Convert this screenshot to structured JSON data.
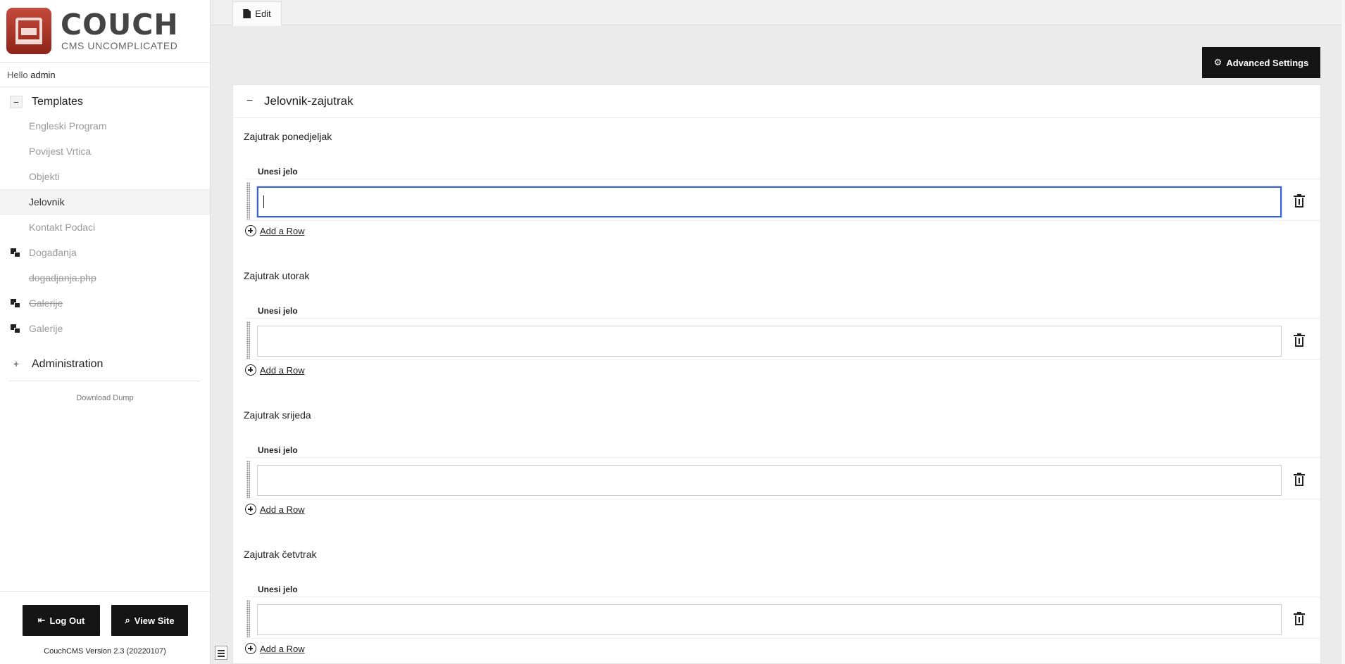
{
  "sidebar": {
    "logo_word": "COUCH",
    "logo_tagline": "CMS UNCOMPLICATED",
    "hello_prefix": "Hello",
    "username": "admin",
    "templates_label": "Templates",
    "templates_toggle": "−",
    "items": [
      {
        "label": "Engleski Program"
      },
      {
        "label": "Povijest Vrtica"
      },
      {
        "label": "Objekti"
      },
      {
        "label": "Jelovnik"
      },
      {
        "label": "Kontakt Podaci"
      },
      {
        "label": "Događanja"
      },
      {
        "label": "dogadjanja.php"
      },
      {
        "label": "Galerije"
      },
      {
        "label": "Galerije"
      }
    ],
    "admin_label": "Administration",
    "admin_toggle": "+",
    "download_label": "Download Dump",
    "logout_label": "Log Out",
    "viewsite_label": "View Site",
    "version": "CouchCMS Version 2.3 (20220107)"
  },
  "tabs": {
    "edit_label": "Edit"
  },
  "toolbar": {
    "advanced_label": "Advanced Settings"
  },
  "panel": {
    "collapse_symbol": "−",
    "title": "Jelovnik-zajutrak",
    "fieldsets": [
      {
        "label": "Zajutrak ponedjeljak",
        "column": "Unesi jelo",
        "value": "",
        "add_label": "Add a Row"
      },
      {
        "label": "Zajutrak utorak",
        "column": "Unesi jelo",
        "value": "",
        "add_label": "Add a Row"
      },
      {
        "label": "Zajutrak srijeda",
        "column": "Unesi jelo",
        "value": "",
        "add_label": "Add a Row"
      },
      {
        "label": "Zajutrak četvtrak",
        "column": "Unesi jelo",
        "value": "",
        "add_label": "Add a Row"
      }
    ]
  },
  "colors": {
    "accent_focus": "#3b63d8",
    "button_dark": "#151515",
    "logo_red": "#a8342a"
  }
}
